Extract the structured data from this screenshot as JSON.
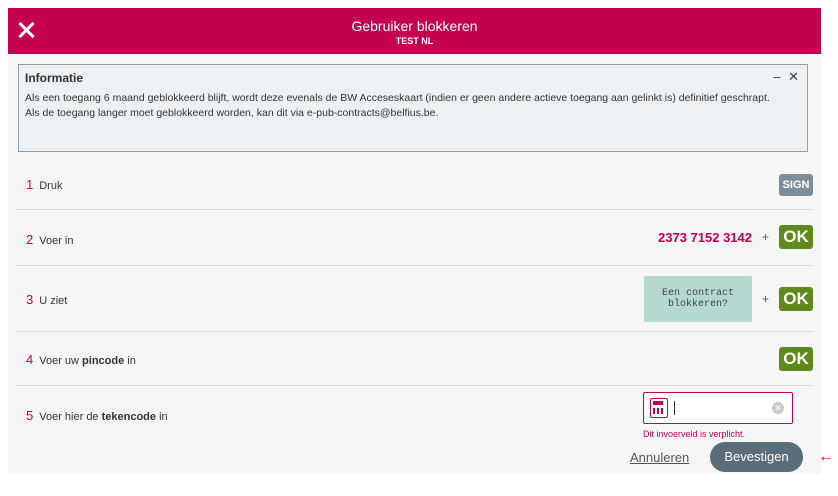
{
  "header": {
    "title": "Gebruiker blokkeren",
    "subtitle": "TEST NL"
  },
  "info": {
    "title": "Informatie",
    "controls": "– ✕",
    "line1": "Als een toegang 6 maand geblokkeerd blijft, wordt deze evenals de BW Acceseskaart (indien er geen andere actieve toegang aan gelinkt is) definitief geschrapt.",
    "line2": "Als de toegang langer moet geblokkeerd worden, kan dit via e-pub-contracts@belfius.be."
  },
  "steps": [
    {
      "num": "1",
      "label": "Druk"
    },
    {
      "num": "2",
      "label": "Voer in",
      "code": "2373 7152 3142"
    },
    {
      "num": "3",
      "label": "U ziet",
      "screen": "Een contract blokkeren?"
    },
    {
      "num": "4",
      "label_before": "Voer uw ",
      "label_bold": "pincode",
      "label_after": " in"
    },
    {
      "num": "5",
      "label_before": "Voer hier de ",
      "label_bold": "tekencode",
      "label_after": " in"
    }
  ],
  "sign_label": "SIGN",
  "ok_label": "OK",
  "plus": "+",
  "input": {
    "value": "",
    "error": "Dit invoerveld is verplicht."
  },
  "actions": {
    "cancel": "Annuleren",
    "confirm": "Bevestigen"
  },
  "colors": {
    "brand": "#c4004e",
    "ok": "#5d8a1a",
    "confirm": "#5b6d78"
  }
}
